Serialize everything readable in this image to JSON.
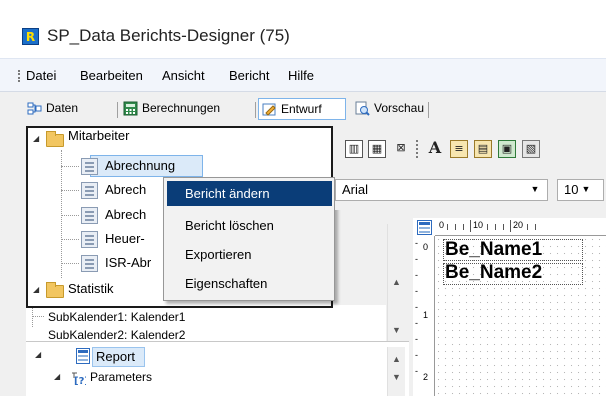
{
  "window": {
    "title": "SP_Data Berichts-Designer (75)",
    "app_icon_letter": "R"
  },
  "menu": [
    "Datei",
    "Bearbeiten",
    "Ansicht",
    "Bericht",
    "Hilfe"
  ],
  "tabs": [
    {
      "label": "Daten",
      "icon": "data-grid-icon",
      "active": false
    },
    {
      "label": "Berechnungen",
      "icon": "calculator-icon",
      "active": false
    },
    {
      "label": "Entwurf",
      "icon": "design-pencil-icon",
      "active": true
    },
    {
      "label": "Vorschau",
      "icon": "preview-magnifier-icon",
      "active": false
    }
  ],
  "tree": {
    "mitarbeiter": "Mitarbeiter",
    "items": [
      "Abrechnung",
      "Abrech",
      "Abrech",
      "Heuer-",
      "ISR-Abr"
    ],
    "statistik": "Statistik",
    "sub1": "SubKalender1: Kalender1",
    "sub2": "SubKalender2: Kalender2"
  },
  "context_menu": [
    {
      "label": "Bericht ändern",
      "highlighted": true
    },
    {
      "label": "Bericht löschen",
      "highlighted": false
    },
    {
      "label": "Exportieren",
      "highlighted": false
    },
    {
      "label": "Eigenschaften",
      "highlighted": false
    }
  ],
  "report_tree": {
    "report": "Report",
    "parameters": "Parameters"
  },
  "designer": {
    "font_name": "Arial",
    "font_size": "10",
    "ruler_top_marks": [
      "0",
      "10",
      "20"
    ],
    "ruler_left_marks": [
      "0",
      "1",
      "2"
    ],
    "fields": [
      "Be_Name1",
      "Be_Name2"
    ]
  },
  "colors": {
    "highlight": "#0a3d78",
    "tab_active_border": "#7eb4ea"
  }
}
